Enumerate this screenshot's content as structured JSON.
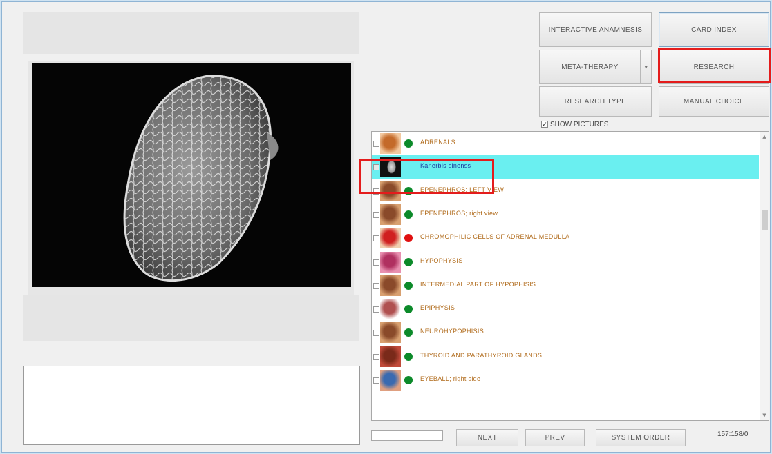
{
  "buttons": {
    "anamnesis": "INTERACTIVE ANAMNESIS",
    "card_index": "CARD INDEX",
    "meta_therapy": "META-THERAPY",
    "research": "RESEARCH",
    "research_type": "RESEARCH TYPE",
    "manual_choice": "MANUAL CHOICE",
    "next": "NEXT",
    "prev": "PREV",
    "system_order": "SYSTEM ORDER"
  },
  "show_pictures": {
    "label": "SHOW PICTURES",
    "checked": true
  },
  "list": {
    "items": [
      {
        "label": "ADRENALS",
        "status": "green",
        "thumb": "adrenals-thumbnail",
        "checked": false,
        "selected": false
      },
      {
        "label": "Kanerbis sinenss",
        "status": "none",
        "thumb": "seed-micrograph-thumbnail",
        "checked": true,
        "selected": true
      },
      {
        "label": "EPENEPHROS; LEFT VIEW",
        "status": "green",
        "thumb": "tissue-thumbnail",
        "checked": false,
        "selected": false
      },
      {
        "label": "EPENEPHROS; right view",
        "status": "green",
        "thumb": "tissue-thumbnail",
        "checked": false,
        "selected": false
      },
      {
        "label": "CHROMOPHILIC CELLS OF ADRENAL MEDULLA",
        "status": "red",
        "thumb": "cell-thumbnail",
        "checked": false,
        "selected": false
      },
      {
        "label": "HYPOPHYSIS",
        "status": "green",
        "thumb": "organ-thumbnail",
        "checked": false,
        "selected": false
      },
      {
        "label": "INTERMEDIAL PART OF HYPOPHISIS",
        "status": "green",
        "thumb": "tissue-thumbnail",
        "checked": false,
        "selected": false
      },
      {
        "label": "EPIPHYSIS",
        "status": "green",
        "thumb": "cells-thumbnail",
        "checked": false,
        "selected": false
      },
      {
        "label": "NEUROHYPOPHISIS",
        "status": "green",
        "thumb": "tissue-thumbnail",
        "checked": false,
        "selected": false
      },
      {
        "label": "THYROID  AND  PARATHYROID  GLANDS",
        "status": "green",
        "thumb": "gland-thumbnail",
        "checked": false,
        "selected": false
      },
      {
        "label": "EYEBALL; right  side",
        "status": "green",
        "thumb": "eyeball-thumbnail",
        "checked": false,
        "selected": false
      }
    ]
  },
  "counter": "157:158/0",
  "colors": {
    "selected_row": "#6aeff0",
    "highlight": "#e41c1c",
    "status_green": "#0c8a2a",
    "status_red": "#e01010",
    "label_text": "#b06a1a"
  }
}
